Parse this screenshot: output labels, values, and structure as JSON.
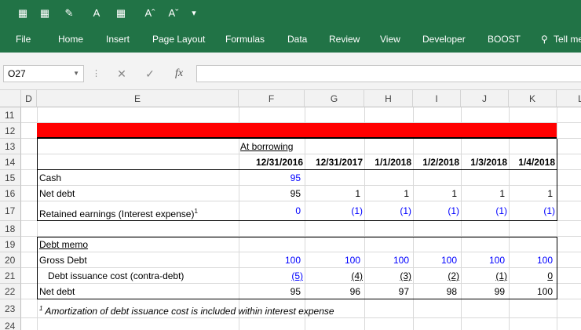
{
  "ribbon": {
    "tabs": [
      "File",
      "Home",
      "Insert",
      "Page Layout",
      "Formulas",
      "Data",
      "Review",
      "View",
      "Developer",
      "BOOST",
      "Tell me"
    ]
  },
  "formula_bar": {
    "name_box": "O27",
    "fx_label": "fx",
    "formula": ""
  },
  "columns": [
    "D",
    "E",
    "F",
    "G",
    "H",
    "I",
    "J",
    "K",
    "L"
  ],
  "rows": [
    "11",
    "12",
    "13",
    "14",
    "15",
    "16",
    "17",
    "18",
    "19",
    "20",
    "21",
    "22",
    "23",
    "24"
  ],
  "sheet": {
    "at_borrowing": "At borrowing",
    "dates": [
      "12/31/2016",
      "12/31/2017",
      "1/1/2018",
      "1/2/2018",
      "1/3/2018",
      "1/4/2018"
    ],
    "cash_label": "Cash",
    "cash": [
      "95"
    ],
    "net_debt_label": "Net debt",
    "net_debt": [
      "95",
      "1",
      "1",
      "1",
      "1",
      "1"
    ],
    "retained_label": "Retained earnings (Interest expense)",
    "footnote_mark": "1",
    "retained": [
      "0",
      "(1)",
      "(1)",
      "(1)",
      "(1)",
      "(1)"
    ],
    "memo_title": "Debt memo",
    "gross_debt_label": "Gross Debt",
    "gross_debt": [
      "100",
      "100",
      "100",
      "100",
      "100",
      "100"
    ],
    "issuance_label": "Debt issuance cost (contra-debt)",
    "issuance": [
      "(5)",
      "(4)",
      "(3)",
      "(2)",
      "(1)",
      "0"
    ],
    "memo_net_label": "Net debt",
    "memo_net": [
      "95",
      "96",
      "97",
      "98",
      "99",
      "100"
    ],
    "footnote": "Amortization of debt issuance cost is included within interest expense"
  },
  "colors": {
    "ribbon": "#217346",
    "header_bar": "#ff0000",
    "input_blue": "#0000ff"
  }
}
